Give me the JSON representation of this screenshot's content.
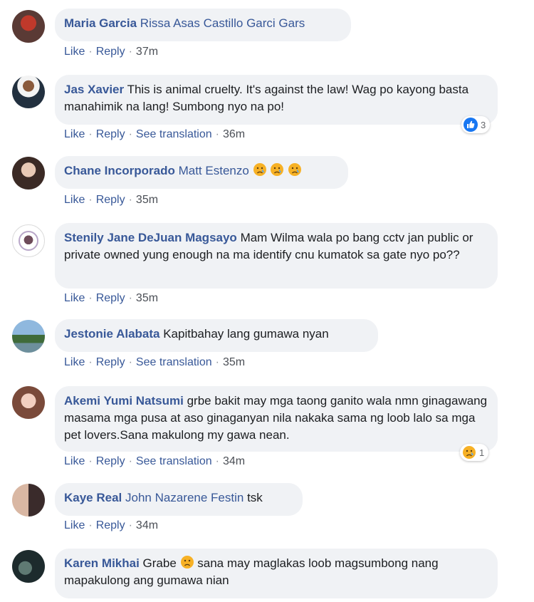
{
  "comments": [
    {
      "author": "Maria Garcia",
      "text": "",
      "mention": "Rissa Asas Castillo Garci Gars",
      "actions": [
        "Like",
        "Reply"
      ],
      "time": "37m"
    },
    {
      "author": "Jas Xavier",
      "text": "This is animal cruelty. It's against the law! Wag po kayong basta manahimik na lang! Sumbong nyo na po!",
      "mention": "",
      "actions": [
        "Like",
        "Reply",
        "See translation"
      ],
      "time": "36m",
      "reaction_count": "3",
      "reaction_icon": "like-icon"
    },
    {
      "author": "Chane Incorporado",
      "text": "",
      "mention": "Matt Estenzo",
      "actions": [
        "Like",
        "Reply"
      ],
      "time": "35m",
      "emoji_count": 3
    },
    {
      "author": "Stenily Jane DeJuan Magsayo",
      "text": "Mam Wilma wala po bang cctv jan public or private owned yung enough na ma identify cnu kumatok sa gate nyo po??",
      "mention": "",
      "actions": [
        "Like",
        "Reply"
      ],
      "time": "35m"
    },
    {
      "author": "Jestonie Alabata",
      "text": "Kapitbahay lang gumawa nyan",
      "mention": "",
      "actions": [
        "Like",
        "Reply",
        "See translation"
      ],
      "time": "35m"
    },
    {
      "author": "Akemi Yumi Natsumi",
      "text": "grbe bakit may mga taong ganito wala nmn ginagawang masama mga pusa at aso ginaganyan nila nakaka sama ng loob lalo sa mga pet lovers.Sana makulong my gawa nean.",
      "mention": "",
      "actions": [
        "Like",
        "Reply",
        "See translation"
      ],
      "time": "34m",
      "reaction_count": "1",
      "reaction_icon": "sad-icon"
    },
    {
      "author": "Kaye Real",
      "text": "tsk",
      "mention": "John Nazarene Festin",
      "actions": [
        "Like",
        "Reply"
      ],
      "time": "34m"
    },
    {
      "author": "Karen Mikhai",
      "text": "Grabe",
      "text2": "sana may maglakas loob magsumbong nang mapakulong ang gumawa nian",
      "mention": "",
      "actions": [],
      "time": ""
    }
  ],
  "colors": {
    "link": "#385898",
    "bubble": "#f0f2f5",
    "like_blue": "#1877f2",
    "sad_yellow": "#f7b125"
  }
}
